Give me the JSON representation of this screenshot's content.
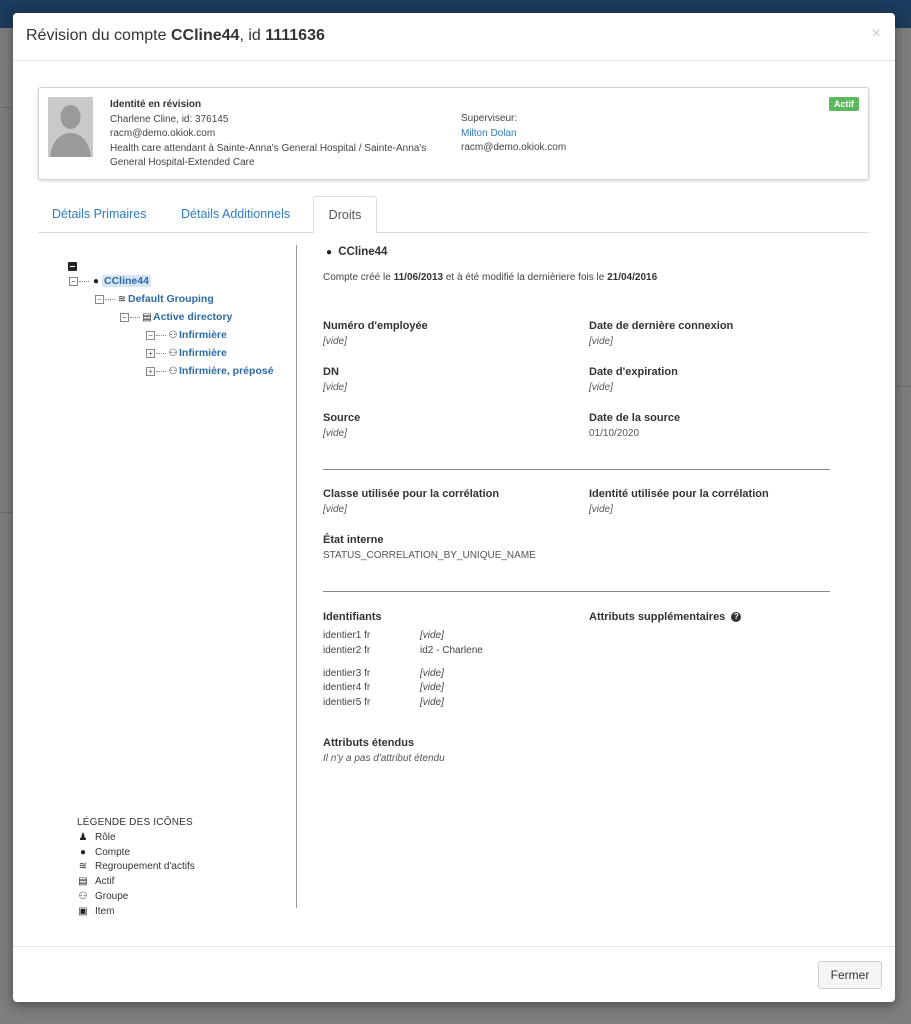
{
  "modal": {
    "title_prefix": "Révision du compte ",
    "account_name": "CCline44",
    "title_mid": ", id ",
    "account_id": "1111636",
    "close_glyph": "×"
  },
  "identity": {
    "header": "Identité en révision",
    "line1": "Charlene Cline, id: 376145",
    "line2": "racm@demo.okiok.com",
    "line3": "Health care attendant à Sainte-Anna's General Hospital / Sainte-Anna's General Hospital-Extended Care",
    "status": "Actif",
    "supervisor_label": "Superviseur:",
    "supervisor_name": "Milton Dolan",
    "supervisor_email": "racm@demo.okiok.com"
  },
  "tabs": [
    {
      "label": "Détails Primaires"
    },
    {
      "label": "Détails Additionnels"
    },
    {
      "label": "Droits"
    }
  ],
  "tree": {
    "root": "CCline44",
    "grouping": "Default Grouping",
    "asset": "Active directory",
    "groups": [
      "Infirmière",
      "Infirmière",
      "Infirmière, préposé"
    ]
  },
  "legend": {
    "title": "LÉGENDE DES ICÔNES",
    "items": [
      {
        "label": "Rôle",
        "icon": "role-icon"
      },
      {
        "label": "Compte",
        "icon": "account-icon"
      },
      {
        "label": "Regroupement d'actifs",
        "icon": "asset-grouping-icon"
      },
      {
        "label": "Actif",
        "icon": "asset-icon"
      },
      {
        "label": "Groupe",
        "icon": "group-icon"
      },
      {
        "label": "Item",
        "icon": "item-icon"
      }
    ]
  },
  "detail": {
    "account": "CCline44",
    "sub_prefix": "Compte créé le ",
    "created": "11/06/2013",
    "sub_mid": " et à été modifié la dernièriere fois le ",
    "modified": "21/04/2016",
    "fields": {
      "employee_no": {
        "label": "Numéro d'employée",
        "value": "[vide]"
      },
      "last_login": {
        "label": "Date de dernière connexion",
        "value": "[vide]"
      },
      "dn": {
        "label": "DN",
        "value": "[vide]"
      },
      "expiration": {
        "label": "Date d'expiration",
        "value": "[vide]"
      },
      "source": {
        "label": "Source",
        "value": "[vide]"
      },
      "source_date": {
        "label": "Date de la source",
        "value": "01/10/2020"
      },
      "corr_class": {
        "label": "Classe utilisée pour la corrélation",
        "value": "[vide]"
      },
      "corr_identity": {
        "label": "Identité utilisée pour la corrélation",
        "value": "[vide]"
      },
      "internal_state": {
        "label": "État interne",
        "value": "STATUS_CORRELATION_BY_UNIQUE_NAME"
      }
    },
    "identifiers_label": "Identifiants",
    "identifiers": [
      {
        "name": "identier1 fr",
        "value": "[vide]"
      },
      {
        "name": "identier2 fr",
        "value": "id2 - Charlene"
      },
      {
        "name": "identier3 fr",
        "value": "[vide]"
      },
      {
        "name": "identier4 fr",
        "value": "[vide]"
      },
      {
        "name": "identier5 fr",
        "value": "[vide]"
      }
    ],
    "extra_attrs_label": "Attributs supplémentaires",
    "extended_label": "Attributs étendus",
    "extended_empty": "Il n'y a pas d'attribut étendu"
  },
  "footer": {
    "close_label": "Fermer"
  }
}
